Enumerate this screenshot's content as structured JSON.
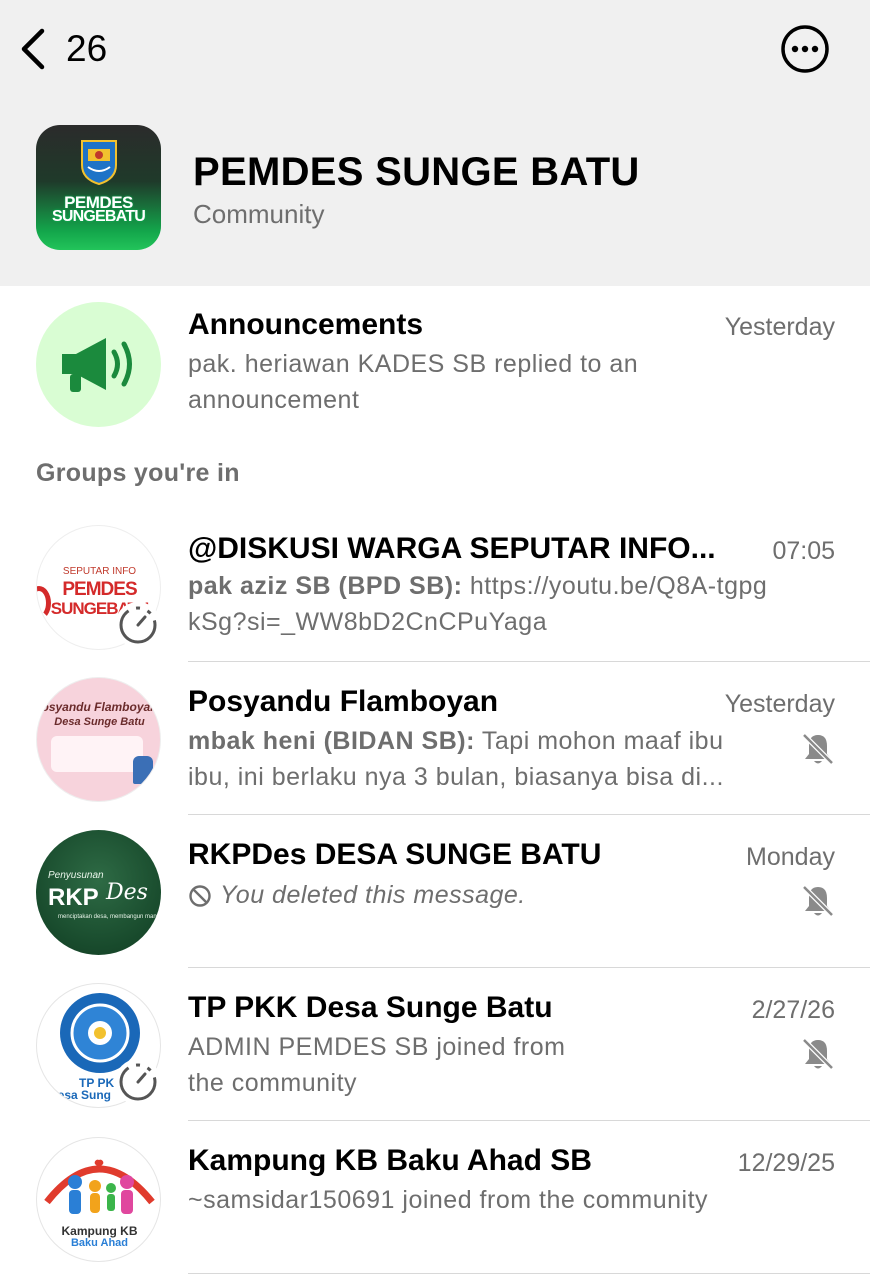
{
  "header": {
    "back_count": "26",
    "community_name": "PEMDES SUNGE BATU",
    "community_type": "Community",
    "logo_text_line1": "PEMDES",
    "logo_text_line2": "SUNGEBATU"
  },
  "announcements": {
    "title": "Announcements",
    "time": "Yesterday",
    "preview": "pak. heriawan KADES SB replied to an announcement",
    "icon": "megaphone-icon",
    "avatar_bg": "#d9fdd3",
    "icon_color": "#1b8a3d"
  },
  "groups_label": "Groups you're in",
  "groups": [
    {
      "title": "@DISKUSI WARGA SEPUTAR INFO...",
      "time": "07:05",
      "sender": "pak aziz SB (BPD SB):",
      "message": " https://youtu.be/Q8A-tgpgkSg?si=_WW8bD2CnCPuYaga",
      "avatar_text_small": "SEPUTAR INFO",
      "avatar_text_line1": "PEMDES",
      "avatar_text_line2": "SUNGEBATU"
    },
    {
      "title": "Posyandu Flamboyan",
      "time": "Yesterday",
      "sender": "mbak heni (BIDAN SB):",
      "message": " Tapi mohon maaf ibu ibu, ini berlaku nya 3 bulan, biasanya bisa di...",
      "avatar_text_line1": "osyandu Flamboyan",
      "avatar_text_line2": "Desa Sunge Batu"
    },
    {
      "title": "RKPDes DESA SUNGE BATU",
      "time": "Monday",
      "message": "You deleted this message.",
      "avatar_text_small": "Penyusunan",
      "avatar_text_line1": "RKP",
      "avatar_text_script": "Des",
      "avatar_tagline": "menciptakan desa, membangun manusia"
    },
    {
      "title": "TP PKK Desa Sunge Batu",
      "time": "2/27/26",
      "message": "ADMIN PEMDES SB joined from the community",
      "avatar_text_line1": "TP PK",
      "avatar_text_line2": "Desa Sung"
    },
    {
      "title": "Kampung KB Baku Ahad SB",
      "time": "12/29/25",
      "message": "~samsidar150691 joined from the community",
      "avatar_text_line1": "Kampung KB",
      "avatar_text_line2": "Baku Ahad"
    }
  ]
}
